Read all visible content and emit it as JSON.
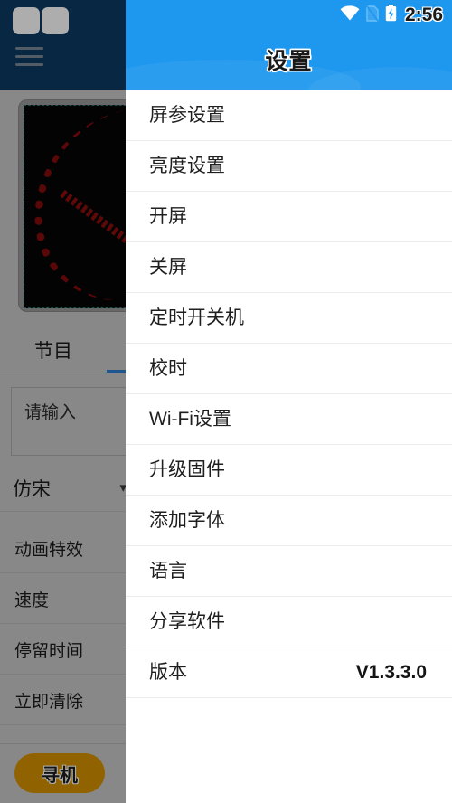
{
  "status_bar": {
    "time": "2:56",
    "icons": [
      "wifi-icon",
      "sim-card-icon",
      "battery-charging-icon"
    ]
  },
  "drawer": {
    "title": "设置",
    "header_color": "#1e97ef",
    "items": [
      {
        "label": "屏参设置",
        "value": ""
      },
      {
        "label": "亮度设置",
        "value": ""
      },
      {
        "label": "开屏",
        "value": ""
      },
      {
        "label": "关屏",
        "value": ""
      },
      {
        "label": "定时开关机",
        "value": ""
      },
      {
        "label": "校时",
        "value": ""
      },
      {
        "label": "Wi-Fi设置",
        "value": ""
      },
      {
        "label": "升级固件",
        "value": ""
      },
      {
        "label": "添加字体",
        "value": ""
      },
      {
        "label": "语言",
        "value": ""
      },
      {
        "label": "分享软件",
        "value": ""
      },
      {
        "label": "版本",
        "value": "V1.3.3.0"
      }
    ]
  },
  "background_app": {
    "header_color": "#0d3a63",
    "preview": {
      "panel_background": "#050505",
      "pixel_color": "#8c0c0c"
    },
    "tab": {
      "label": "节目",
      "indicator_color": "#2f7fd1"
    },
    "input": {
      "placeholder": "请输入",
      "value": ""
    },
    "font_row": {
      "label": "仿宋",
      "arrow": "▾"
    },
    "rows": [
      {
        "label": "动画特效"
      },
      {
        "label": "速度"
      },
      {
        "label": "停留时间"
      },
      {
        "label": "立即清除"
      }
    ],
    "find_button": {
      "label": "寻机",
      "color": "#d59200"
    }
  }
}
